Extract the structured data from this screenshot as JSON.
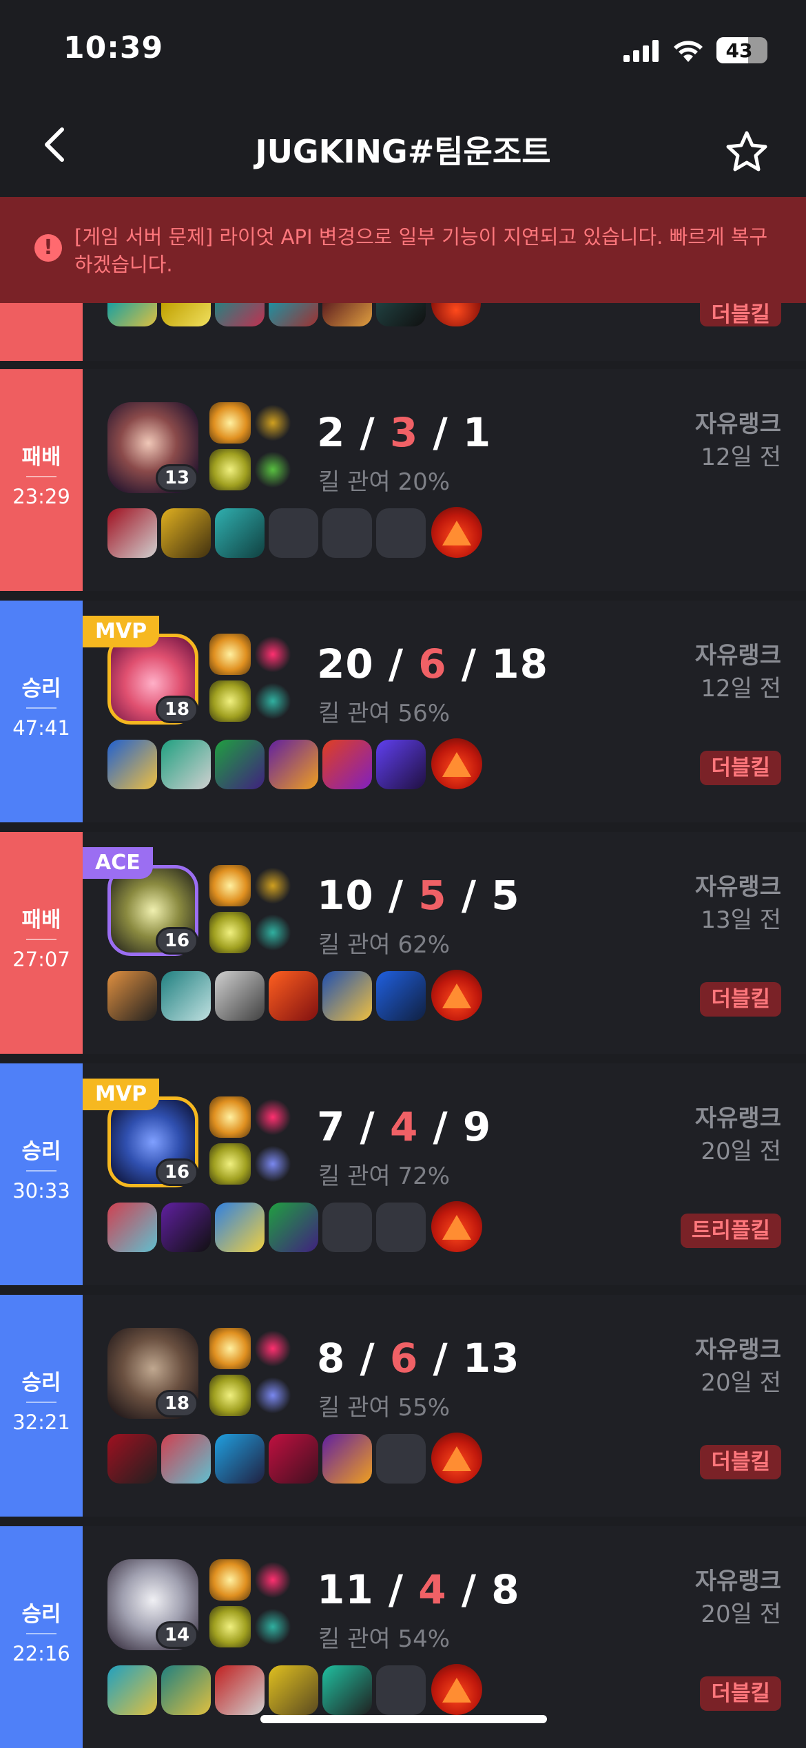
{
  "status": {
    "time": "10:39",
    "battery": "43"
  },
  "nav": {
    "title": "JUGKING#팀운조트"
  },
  "banner": {
    "text": "[게임 서버 문제] 라이엇 API 변경으로 일부 기능이 지연되고 있습니다. 빠르게 복구하겠습니다."
  },
  "partial": {
    "multikill": "더블킬"
  },
  "matches": [
    {
      "result": "패배",
      "duration": "23:29",
      "level": "13",
      "k": "2",
      "d": "3",
      "a": "1",
      "kp": "킬 관여 20%",
      "queue": "자유랭크",
      "ago": "12일 전",
      "badge": "",
      "multikill": ""
    },
    {
      "result": "승리",
      "duration": "47:41",
      "level": "18",
      "k": "20",
      "d": "6",
      "a": "18",
      "kp": "킬 관여 56%",
      "queue": "자유랭크",
      "ago": "12일 전",
      "badge": "MVP",
      "multikill": "더블킬"
    },
    {
      "result": "패배",
      "duration": "27:07",
      "level": "16",
      "k": "10",
      "d": "5",
      "a": "5",
      "kp": "킬 관여 62%",
      "queue": "자유랭크",
      "ago": "13일 전",
      "badge": "ACE",
      "multikill": "더블킬"
    },
    {
      "result": "승리",
      "duration": "30:33",
      "level": "16",
      "k": "7",
      "d": "4",
      "a": "9",
      "kp": "킬 관여 72%",
      "queue": "자유랭크",
      "ago": "20일 전",
      "badge": "MVP",
      "multikill": "트리플킬"
    },
    {
      "result": "승리",
      "duration": "32:21",
      "level": "18",
      "k": "8",
      "d": "6",
      "a": "13",
      "kp": "킬 관여 55%",
      "queue": "자유랭크",
      "ago": "20일 전",
      "badge": "",
      "multikill": "더블킬"
    },
    {
      "result": "승리",
      "duration": "22:16",
      "level": "14",
      "k": "11",
      "d": "4",
      "a": "8",
      "kp": "킬 관여 54%",
      "queue": "자유랭크",
      "ago": "20일 전",
      "badge": "",
      "multikill": "더블킬"
    }
  ],
  "colors": {
    "loss": "#ef5e60",
    "win": "#4f80f8",
    "mvp": "#f6b820",
    "ace": "#9b6ef2",
    "multikill_bg": "#7a2227",
    "multikill_text": "#ff777c"
  }
}
